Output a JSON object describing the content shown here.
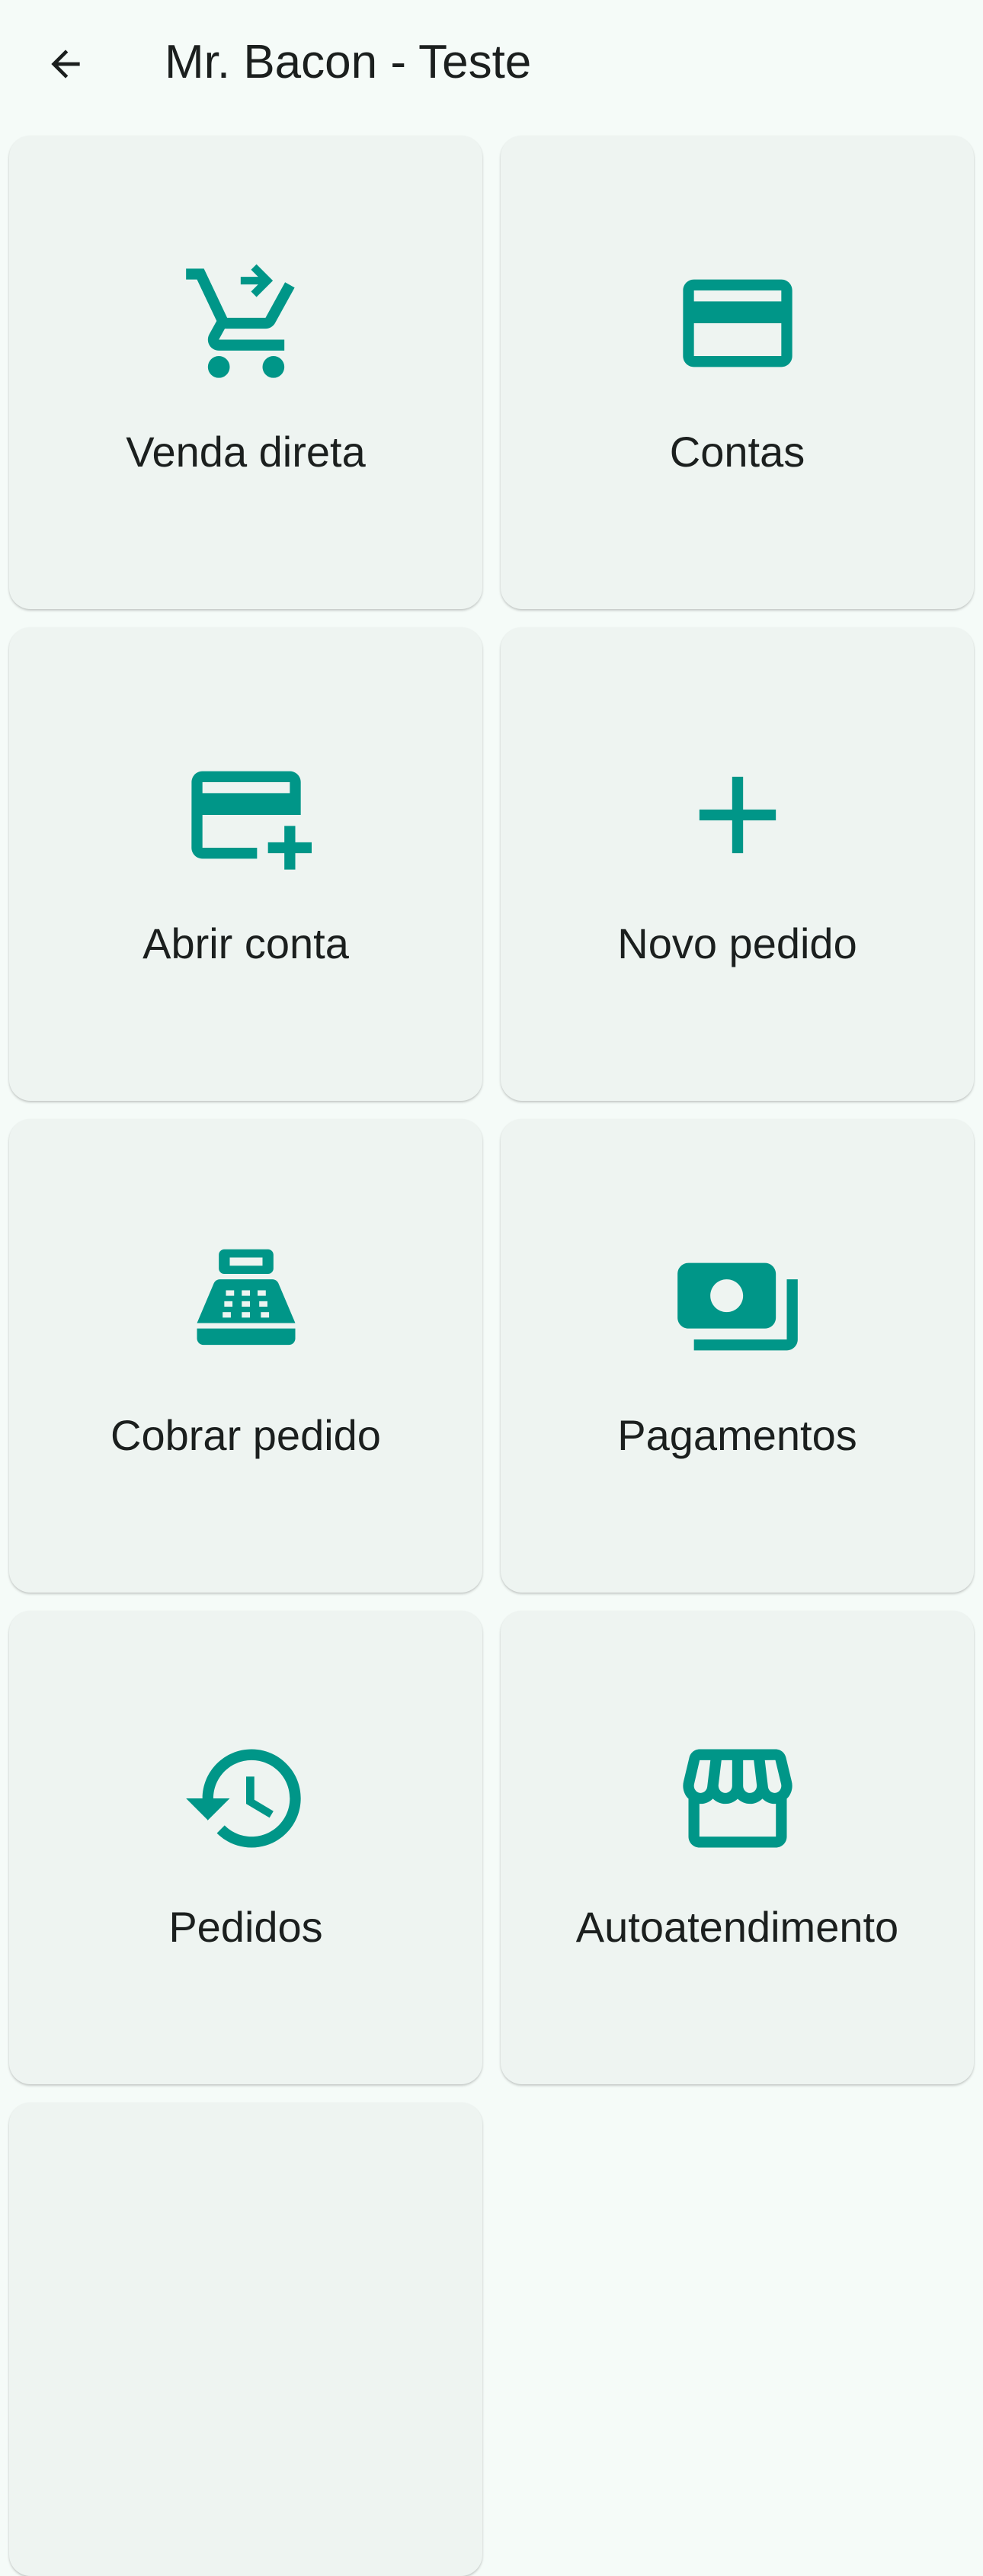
{
  "app_bar": {
    "title": "Mr. Bacon - Teste",
    "back_icon": "arrow-back-icon"
  },
  "colors": {
    "accent": "#009688",
    "background": "#f5fbf8",
    "tile_background": "#eef4f1",
    "text": "#1b1f1e"
  },
  "tiles": [
    {
      "label": "Venda direta",
      "icon": "shopping-cart-checkout-icon"
    },
    {
      "label": "Contas",
      "icon": "credit-card-icon"
    },
    {
      "label": "Abrir conta",
      "icon": "add-card-icon"
    },
    {
      "label": "Novo pedido",
      "icon": "plus-icon"
    },
    {
      "label": "Cobrar pedido",
      "icon": "cash-register-icon"
    },
    {
      "label": "Pagamentos",
      "icon": "payments-icon"
    },
    {
      "label": "Pedidos",
      "icon": "history-icon"
    },
    {
      "label": "Autoatendimento",
      "icon": "storefront-icon"
    }
  ]
}
